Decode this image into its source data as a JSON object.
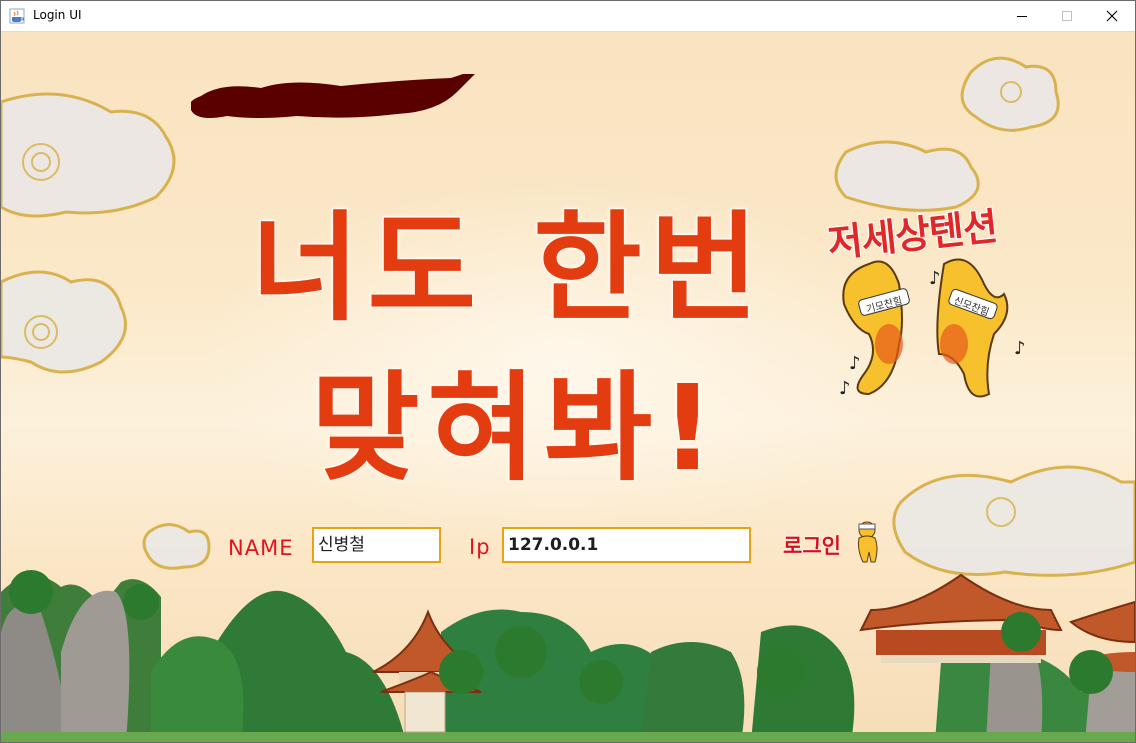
{
  "window": {
    "title": "Login UI",
    "icon": "java-cup-icon"
  },
  "header": {
    "title_line1": "너도 한번",
    "title_line2": "맞혀봐!"
  },
  "tension": {
    "text": "저세상텐션",
    "headband_left": "기모찬힘",
    "headband_right": "신모찬힘"
  },
  "form": {
    "name_label": "NAME",
    "name_value": "신병철",
    "ip_label": "Ip",
    "ip_value": "127.0.0.1",
    "login_label": "로그인"
  },
  "colors": {
    "title": "#e23c10",
    "label": "#e0141e",
    "input_border": "#e9a213"
  }
}
